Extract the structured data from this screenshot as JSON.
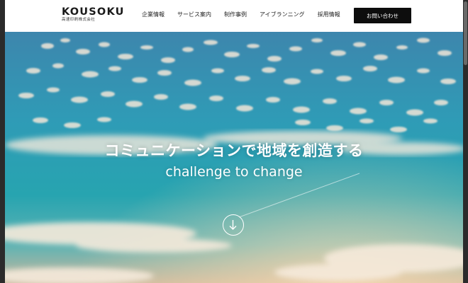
{
  "header": {
    "logo": "KOUSOKU",
    "logo_sub": "高速印刷株式会社",
    "nav": [
      {
        "label": "企業情報"
      },
      {
        "label": "サービス案内"
      },
      {
        "label": "制作事例"
      },
      {
        "label": "アイブランニング"
      },
      {
        "label": "採用情報"
      }
    ],
    "contact_label": "お問い合わせ"
  },
  "hero": {
    "title": "コミュニケーションで地域を創造する",
    "subtitle": "challenge to change",
    "scroll_icon": "arrow-down-circle-icon"
  },
  "colors": {
    "sky_top": "#3f8fb5",
    "sky_mid": "#2aa3b4",
    "sky_bottom": "#e8c7a5",
    "button_bg": "#0d0d0d",
    "header_bg": "#ffffff"
  }
}
